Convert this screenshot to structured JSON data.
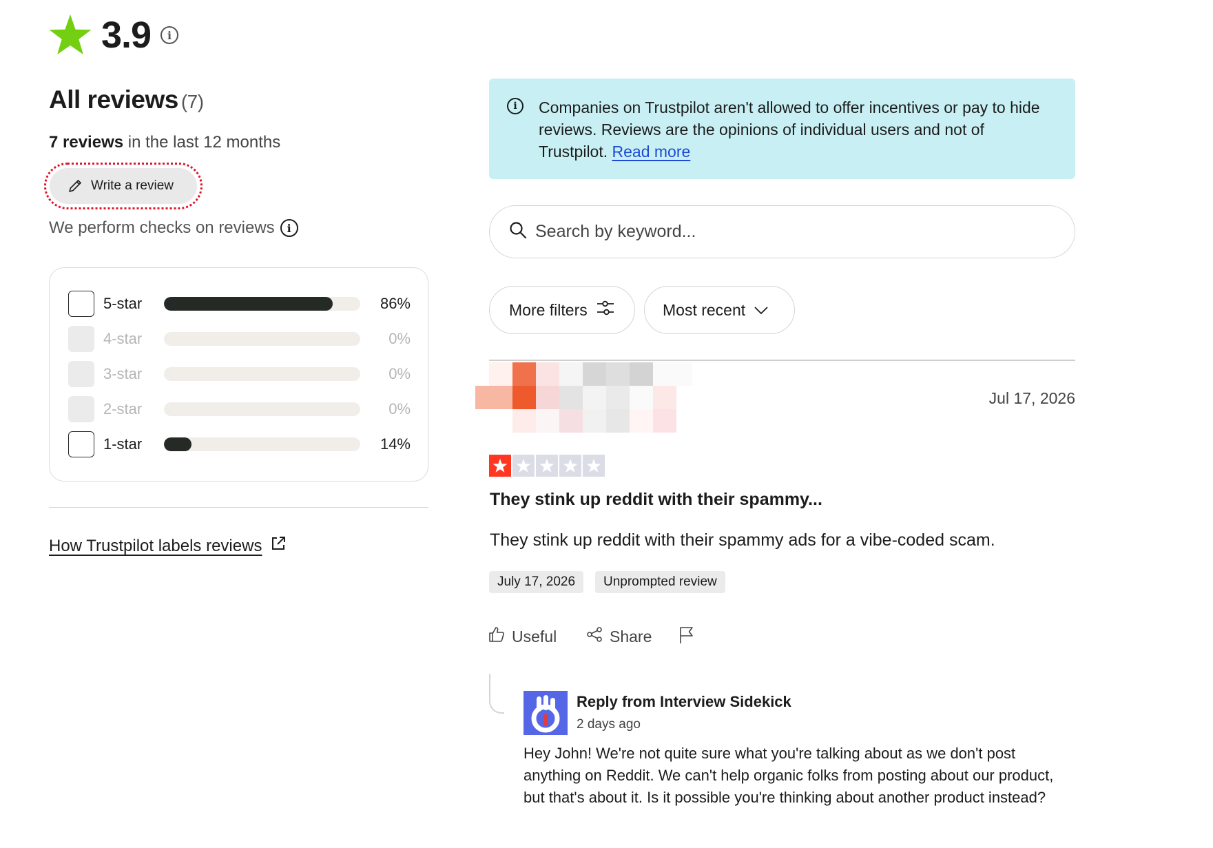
{
  "rating": {
    "value": "3.9",
    "star_icon": "green-star-icon",
    "star_color": "#73cf11"
  },
  "summary": {
    "heading": "All reviews",
    "count": "(7)",
    "recent_bold": "7 reviews",
    "recent_rest": " in the last 12 months",
    "write_review_label": "Write a review",
    "checks_label": "We perform checks on reviews"
  },
  "distribution": [
    {
      "label": "5-star",
      "percent_text": "86%",
      "fill_fraction": 0.86,
      "enabled": true
    },
    {
      "label": "4-star",
      "percent_text": "0%",
      "fill_fraction": 0,
      "enabled": false
    },
    {
      "label": "3-star",
      "percent_text": "0%",
      "fill_fraction": 0,
      "enabled": false
    },
    {
      "label": "2-star",
      "percent_text": "0%",
      "fill_fraction": 0,
      "enabled": false
    },
    {
      "label": "1-star",
      "percent_text": "14%",
      "fill_fraction": 0.14,
      "enabled": true
    }
  ],
  "labels_link": "How Trustpilot labels reviews",
  "notice": {
    "text": "Companies on Trustpilot aren't allowed to offer incentives or pay to hide reviews. Reviews are the opinions of individual users and not of Trustpilot. ",
    "link": "Read more",
    "background": "#c8f0f4"
  },
  "search": {
    "placeholder": "Search by keyword..."
  },
  "filters": {
    "more_filters": "More filters",
    "sort": "Most recent"
  },
  "review": {
    "date_short": "Jul 17, 2026",
    "rating": 1,
    "star_color": "#ff3722",
    "title": "They stink up reddit with their spammy...",
    "body": "They stink up reddit with their spammy ads for a vibe-coded scam.",
    "tag_date": "July 17, 2026",
    "tag_type": "Unprompted review",
    "actions": {
      "useful": "Useful",
      "share": "Share"
    }
  },
  "reply": {
    "from": "Reply from Interview Sidekick",
    "when": "2 days ago",
    "text": "Hey John! We're not quite sure what you're talking about as we don't post anything on Reddit. We can't help organic folks from posting about our product, but that's about it. Is it possible you're thinking about another product instead?",
    "logo_color": "#5566e6"
  }
}
